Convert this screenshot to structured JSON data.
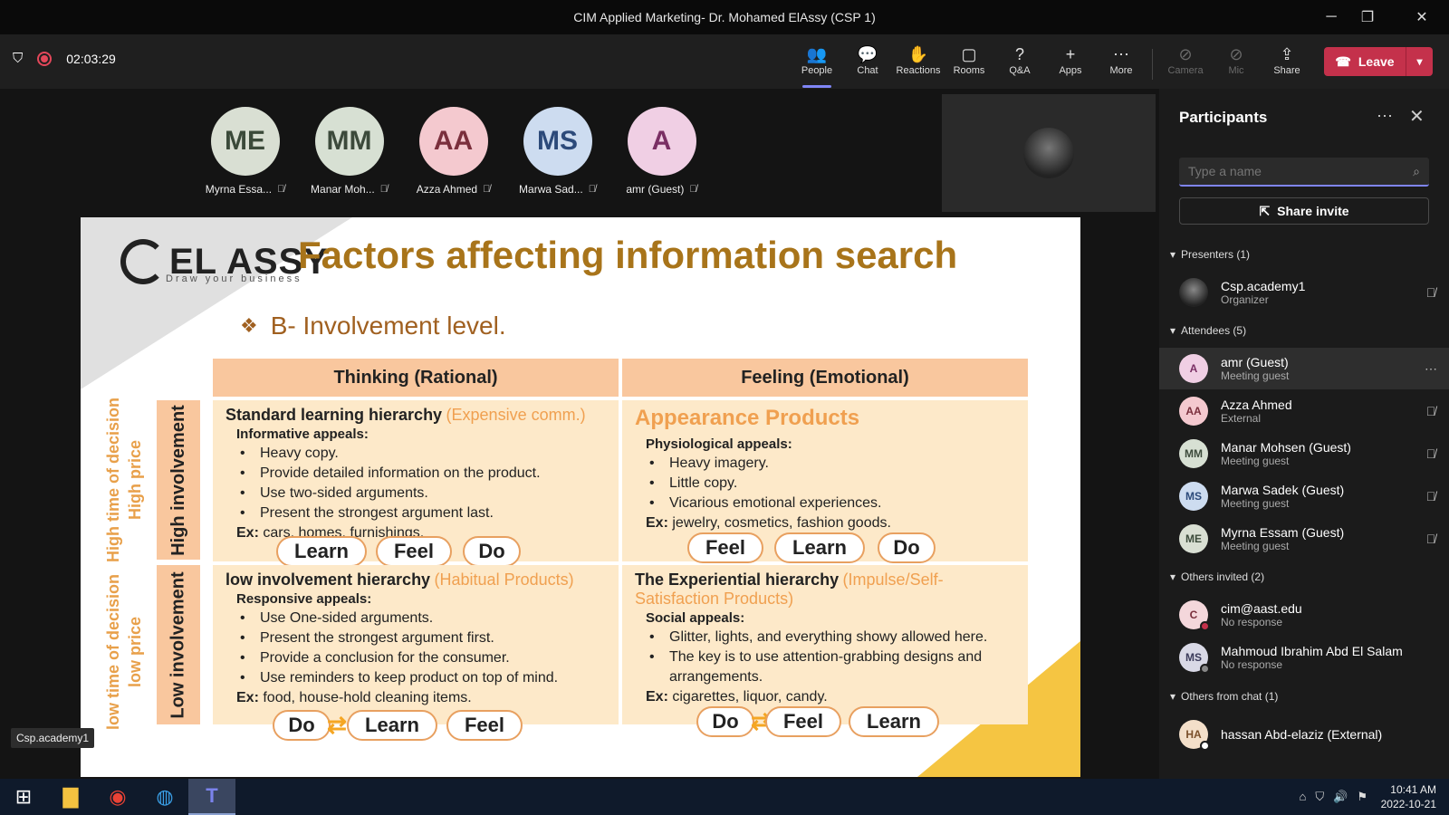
{
  "window": {
    "title": "CIM Applied Marketing- Dr. Mohamed ElAssy (CSP 1)",
    "controls": [
      "─",
      "❐",
      "✕"
    ]
  },
  "toolbar": {
    "timer": "02:03:29",
    "buttons": [
      {
        "label": "People",
        "icon": "people-icon",
        "glyph": "👥"
      },
      {
        "label": "Chat",
        "icon": "chat-icon",
        "glyph": "💬"
      },
      {
        "label": "Reactions",
        "icon": "reactions-icon",
        "glyph": "✋"
      },
      {
        "label": "Rooms",
        "icon": "rooms-icon",
        "glyph": "▢"
      },
      {
        "label": "Q&A",
        "icon": "qa-icon",
        "glyph": "?"
      },
      {
        "label": "Apps",
        "icon": "apps-icon",
        "glyph": "+"
      },
      {
        "label": "More",
        "icon": "more-icon",
        "glyph": "⋯"
      },
      {
        "label": "Camera",
        "icon": "camera-off-icon",
        "glyph": "⊘"
      },
      {
        "label": "Mic",
        "icon": "mic-off-icon",
        "glyph": "⊘"
      },
      {
        "label": "Share",
        "icon": "share-icon",
        "glyph": "⇪"
      }
    ],
    "leave": "Leave"
  },
  "gallery": [
    {
      "initials": "ME",
      "name": "Myrna Essa...",
      "bg": "#d9dfd3",
      "fg": "#3b4a3a"
    },
    {
      "initials": "MM",
      "name": "Manar Moh...",
      "bg": "#d7e0d3",
      "fg": "#3c4a3b"
    },
    {
      "initials": "AA",
      "name": "Azza Ahmed",
      "bg": "#f4c9cf",
      "fg": "#7a2f3c"
    },
    {
      "initials": "MS",
      "name": "Marwa Sad...",
      "bg": "#cddcf0",
      "fg": "#2c4a7a"
    },
    {
      "initials": "A",
      "name": "amr (Guest)",
      "bg": "#f0cfe4",
      "fg": "#7a2f64"
    }
  ],
  "slide": {
    "logo": "EL ASSY",
    "logo_sub": "Draw your business",
    "title": "Factors affecting information search",
    "subtitle": "B- Involvement level.",
    "col1": "Thinking (Rational)",
    "col2": "Feeling (Emotional)",
    "row1_bar": "High involvement",
    "row2_bar": "Low involvement",
    "row1_side": [
      "High time of decision",
      "High price"
    ],
    "row2_side": [
      "low time of decision",
      "low price"
    ],
    "q1": {
      "title": "Standard learning hierarchy",
      "note": "(Expensive comm.)",
      "appeal": "Informative appeals:",
      "items": [
        "Heavy copy.",
        "Provide detailed information on the product.",
        "Use two-sided arguments.",
        "Present the strongest argument last."
      ],
      "ex_label": "Ex:",
      "ex": "cars, homes, furnishings.",
      "pills": [
        "Learn",
        "Feel",
        "Do"
      ]
    },
    "q2": {
      "title": "Appearance Products",
      "appeal": "Physiological appeals:",
      "items": [
        "Heavy imagery.",
        "Little copy.",
        "Vicarious emotional experiences."
      ],
      "ex_label": "Ex:",
      "ex": "jewelry, cosmetics, fashion goods.",
      "pills": [
        "Feel",
        "Learn",
        "Do"
      ]
    },
    "q3": {
      "title": "low involvement hierarchy",
      "note": "(Habitual Products)",
      "appeal": "Responsive appeals:",
      "items": [
        "Use One-sided arguments.",
        "Present the strongest argument first.",
        "Provide a conclusion for the consumer.",
        "Use reminders to keep product on top of mind."
      ],
      "ex_label": "Ex:",
      "ex": "food, house-hold cleaning items.",
      "pills": [
        "Do",
        "Learn",
        "Feel"
      ]
    },
    "q4": {
      "title": "The Experiential hierarchy",
      "note": "(Impulse/Self-Satisfaction Products)",
      "appeal": "Social appeals:",
      "items": [
        "Glitter, lights, and everything showy allowed here.",
        "The key is to use attention-grabbing designs and arrangements."
      ],
      "ex_label": "Ex:",
      "ex": "cigarettes, liquor, candy.",
      "pills": [
        "Do",
        "Feel",
        "Learn"
      ]
    }
  },
  "presenter_tag": "Csp.academy1",
  "panel": {
    "title": "Participants",
    "search_placeholder": "Type a name",
    "share_invite": "Share invite",
    "presenters_header": "Presenters (1)",
    "attendees_header": "Attendees (5)",
    "invited_header": "Others invited (2)",
    "chat_header": "Others from chat (1)",
    "presenters": [
      {
        "initials": "",
        "name": "Csp.academy1",
        "role": "Organizer"
      }
    ],
    "attendees": [
      {
        "initials": "A",
        "name": "amr (Guest)",
        "role": "Meeting guest",
        "bg": "#f0cfe4",
        "fg": "#7a2f64"
      },
      {
        "initials": "AA",
        "name": "Azza Ahmed",
        "role": "External",
        "bg": "#f4c9cf",
        "fg": "#7a2f3c"
      },
      {
        "initials": "MM",
        "name": "Manar Mohsen (Guest)",
        "role": "Meeting guest",
        "bg": "#d7e0d3",
        "fg": "#3c4a3b"
      },
      {
        "initials": "MS",
        "name": "Marwa Sadek (Guest)",
        "role": "Meeting guest",
        "bg": "#cddcf0",
        "fg": "#2c4a7a"
      },
      {
        "initials": "ME",
        "name": "Myrna Essam (Guest)",
        "role": "Meeting guest",
        "bg": "#d9dfd3",
        "fg": "#3b4a3a"
      }
    ],
    "invited": [
      {
        "initials": "C",
        "name": "cim@aast.edu",
        "role": "No response",
        "bg": "#f4d7db",
        "fg": "#7a2f3c"
      },
      {
        "initials": "MS",
        "name": "Mahmoud Ibrahim Abd El Salam",
        "role": "No response",
        "bg": "#d9d9e6",
        "fg": "#3b3b5a"
      }
    ],
    "chat": [
      {
        "initials": "HA",
        "name": "hassan Abd-elaziz (External)",
        "bg": "#f3dfc9",
        "fg": "#7a4f2a"
      }
    ]
  },
  "taskbar": {
    "time": "10:41 AM",
    "date": "2022-10-21"
  }
}
